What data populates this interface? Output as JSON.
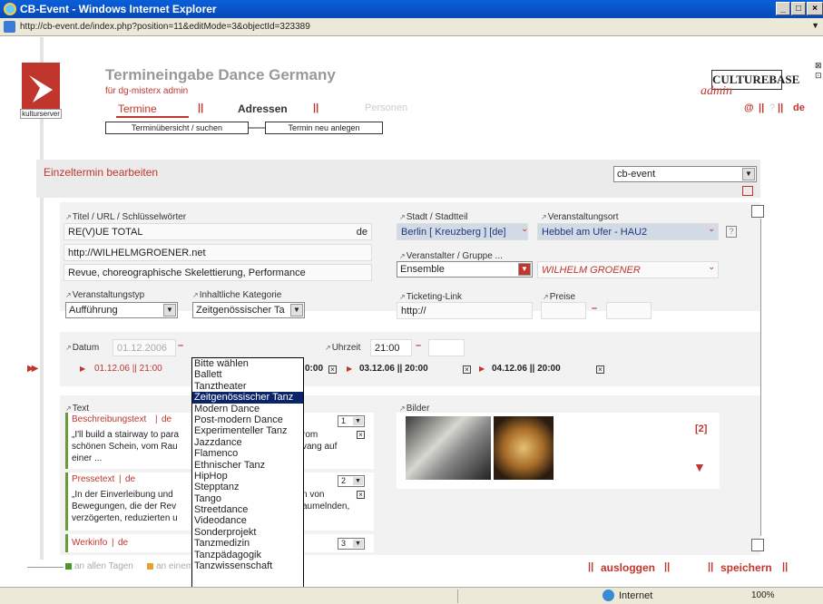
{
  "window": {
    "title": "CB-Event - Windows Internet Explorer",
    "min": "_",
    "max": "□",
    "close": "×"
  },
  "address": {
    "url": "http://cb-event.de/index.php?position=11&editMode=3&objectId=323389"
  },
  "header": {
    "title": "Termineingabe Dance Germany",
    "subtitle": "für  dg-misterx admin",
    "logo_label": "kulturserver",
    "brand": "CULTUREBASE",
    "brand_sub": "admin",
    "nav": {
      "termine": "Termine",
      "adressen": "Adressen",
      "personen": "Personen",
      "sep": "||"
    },
    "right_links": {
      "at": "@",
      "q": "?",
      "lang": "de",
      "sep": "||"
    },
    "subnav": {
      "search": "Terminübersicht / suchen",
      "new": "Termin neu anlegen"
    }
  },
  "section": {
    "title": "Einzeltermin bearbeiten",
    "instance_select": "cb-event"
  },
  "form": {
    "title_label": "Titel / URL / Schlüsselwörter",
    "title_value": "RE(V)UE TOTAL",
    "title_lang": "de",
    "url_value": "http://WILHELMGROENER.net",
    "keywords_value": "Revue, choreographische Skelettierung, Performance",
    "city_label": "Stadt / Stadtteil",
    "city_value": "Berlin [ Kreuzberg ] [de]",
    "venue_label": "Veranstaltungsort",
    "venue_value": "Hebbel am Ufer - HAU2",
    "help": "?",
    "organizer_label": "Veranstalter / Gruppe ...",
    "organizer_type": "Ensemble",
    "organizer_value": "WILHELM GROENER",
    "eventtype_label": "Veranstaltungstyp",
    "eventtype_value": "Aufführung",
    "category_label": "Inhaltliche Kategorie",
    "category_value": "Zeitgenössischer Ta",
    "ticket_label": "Ticketing-Link",
    "ticket_value": "http://",
    "price_label": "Preise",
    "date_label": "Datum",
    "date_value": "01.12.2006",
    "time_label": "Uhrzeit",
    "time_value": "21:00",
    "dash": "–"
  },
  "dates": [
    {
      "text": "01.12.06  ||  21:00"
    },
    {
      "text": "0:00"
    },
    {
      "text": "03.12.06  ||  20:00"
    },
    {
      "text": "04.12.06  ||  20:00"
    }
  ],
  "category_options": [
    "Bitte wählen",
    "Ballett",
    "Tanztheater",
    "Zeitgenössischer Tanz",
    "Modern Dance",
    "Post-modern Dance",
    "Experimenteller Tanz",
    "Jazzdance",
    "Flamenco",
    "Ethnischer Tanz",
    "HipHop",
    "Stepptanz",
    "Tango",
    "Streetdance",
    "Videodance",
    "Sonderprojekt",
    "Tanzmedizin",
    "Tanzpädagogik",
    "Tanzwissenschaft"
  ],
  "text_section": {
    "label": "Text",
    "desc_title": "Beschreibungstext",
    "desc_lang": "de",
    "desc_body_a": "„I'll build a stairway to para",
    "desc_body_b": "rom",
    "desc_body_c": "schönen Schein, vom Rau",
    "desc_body_d": "vang auf",
    "desc_body_e": "einer ...",
    "desc_num": "1",
    "press_title": "Pressetext",
    "press_lang": "de",
    "press_body_a": "„In der Einverleibung und",
    "press_body_b": "n von",
    "press_body_c": "Bewegungen, die der Rev",
    "press_body_d": "aumelnden,",
    "press_body_e": "verzögerten, reduzierten u",
    "press_num": "2",
    "work_title": "Werkinfo",
    "work_lang": "de",
    "work_num": "3"
  },
  "images": {
    "label": "Bilder",
    "count": "[2]"
  },
  "footer": {
    "all_days": "an allen Tagen",
    "one_day": "an einem Tag",
    "logout": "ausloggen",
    "save": "speichern",
    "sep": "||"
  },
  "status": {
    "zone": "Internet",
    "zoom": "100%"
  },
  "colors": {
    "accent": "#c0362c",
    "ie_blue": "#0a5fd8",
    "highlight": "#0a246a"
  }
}
